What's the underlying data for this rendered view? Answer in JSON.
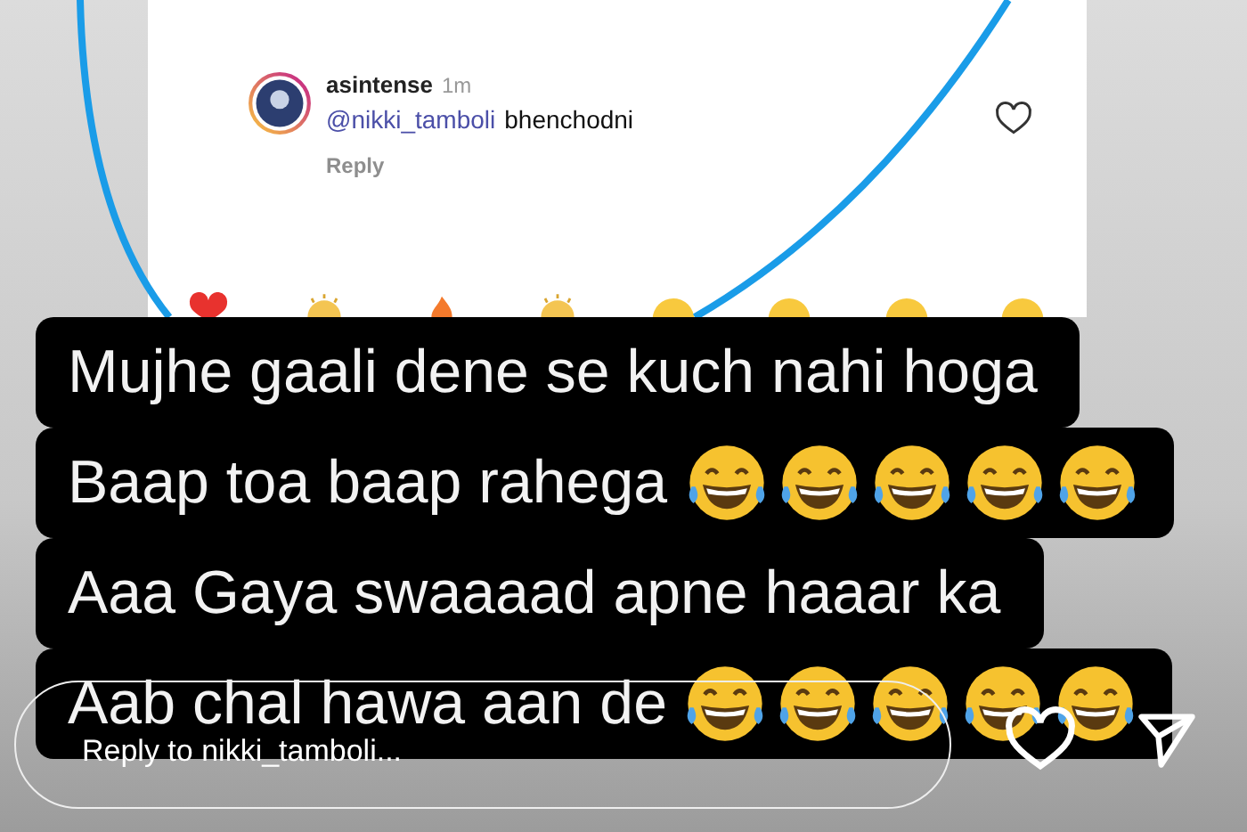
{
  "comment": {
    "username": "asintense",
    "time": "1m",
    "mention": "@nikki_tamboli",
    "text": "bhenchodni",
    "reply": "Reply",
    "liked": false
  },
  "reactions": [
    {
      "kind": "heart"
    },
    {
      "kind": "raised-hands"
    },
    {
      "kind": "fire"
    },
    {
      "kind": "clap"
    },
    {
      "kind": "face"
    },
    {
      "kind": "face"
    },
    {
      "kind": "face"
    },
    {
      "kind": "face"
    }
  ],
  "caption": [
    {
      "text": "Mujhe gaali dene se kuch nahi hoga"
    },
    {
      "text": "Baap toa baap rahega",
      "emojis": [
        {
          "kind": "laugh"
        },
        {
          "kind": "laugh"
        },
        {
          "kind": "laugh"
        },
        {
          "kind": "laugh"
        },
        {
          "kind": "laugh"
        }
      ]
    },
    {
      "text": "Aaa Gaya swaaaad apne haaar ka"
    },
    {
      "text": "Aab chal hawa aan de",
      "emojis": [
        {
          "kind": "laugh"
        },
        {
          "kind": "laugh"
        },
        {
          "kind": "laugh"
        },
        {
          "kind": "laugh"
        },
        {
          "kind": "laugh"
        }
      ]
    }
  ],
  "reply_bar": {
    "placeholder": "Reply to nikki_tamboli..."
  }
}
